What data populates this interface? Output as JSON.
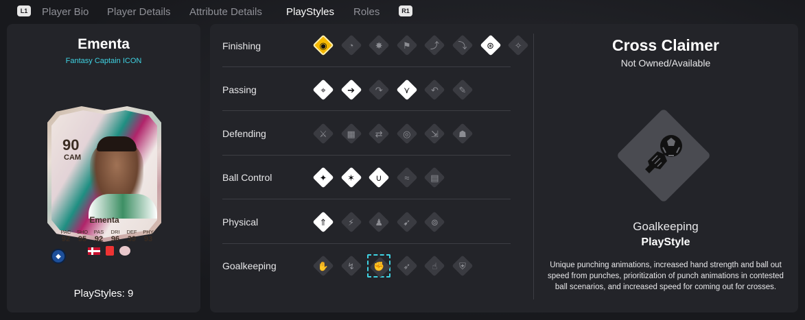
{
  "nav": {
    "left_button": "L1",
    "right_button": "R1",
    "tabs": [
      {
        "label": "Player Bio",
        "active": false
      },
      {
        "label": "Player Details",
        "active": false
      },
      {
        "label": "Attribute Details",
        "active": false
      },
      {
        "label": "PlayStyles",
        "active": true
      },
      {
        "label": "Roles",
        "active": false
      }
    ]
  },
  "player": {
    "name": "Ementa",
    "version": "Fantasy Captain ICON",
    "playstyles_count_label": "PlayStyles: 9",
    "card": {
      "rating": "90",
      "position": "CAM",
      "name": "Ementa",
      "stat_labels": [
        "PAC",
        "SHO",
        "PAS",
        "DRI",
        "DEF",
        "PHY"
      ],
      "stat_values": [
        "92",
        "95",
        "92",
        "96",
        "39",
        "93"
      ],
      "nation": "Denmark"
    }
  },
  "categories": [
    {
      "label": "Finishing",
      "icons": [
        {
          "name": "finesse-shot-icon",
          "state": "plus",
          "glyph": "◉"
        },
        {
          "name": "chip-shot-icon",
          "state": "locked",
          "glyph": "◔"
        },
        {
          "name": "power-shot-icon",
          "state": "locked",
          "glyph": "✸"
        },
        {
          "name": "dead-ball-icon",
          "state": "locked",
          "glyph": "⚑"
        },
        {
          "name": "precision-header-icon",
          "state": "locked",
          "glyph": "⤴"
        },
        {
          "name": "acrobatic-icon",
          "state": "locked",
          "glyph": "⤵"
        },
        {
          "name": "low-driven-shot-icon",
          "state": "owned",
          "glyph": "⊛"
        },
        {
          "name": "gamechanger-icon",
          "state": "locked",
          "glyph": "✧"
        }
      ]
    },
    {
      "label": "Passing",
      "icons": [
        {
          "name": "incisive-pass-icon",
          "state": "owned",
          "glyph": "⌖"
        },
        {
          "name": "pinged-pass-icon",
          "state": "owned",
          "glyph": "➔"
        },
        {
          "name": "long-ball-pass-icon",
          "state": "locked",
          "glyph": "↷"
        },
        {
          "name": "tiki-taka-icon",
          "state": "owned",
          "glyph": "⋎"
        },
        {
          "name": "whipped-pass-icon",
          "state": "locked",
          "glyph": "↶"
        },
        {
          "name": "inventive-icon",
          "state": "locked",
          "glyph": "✎"
        }
      ]
    },
    {
      "label": "Defending",
      "icons": [
        {
          "name": "jockey-icon",
          "state": "locked",
          "glyph": "⚔"
        },
        {
          "name": "block-icon",
          "state": "locked",
          "glyph": "▦"
        },
        {
          "name": "intercept-icon",
          "state": "locked",
          "glyph": "⇄"
        },
        {
          "name": "anticipate-icon",
          "state": "locked",
          "glyph": "◎"
        },
        {
          "name": "slide-tackle-icon",
          "state": "locked",
          "glyph": "⇲"
        },
        {
          "name": "bruiser-icon",
          "state": "locked",
          "glyph": "☗"
        }
      ]
    },
    {
      "label": "Ball Control",
      "icons": [
        {
          "name": "technical-icon",
          "state": "owned",
          "glyph": "✦"
        },
        {
          "name": "rapid-icon",
          "state": "owned",
          "glyph": "✶"
        },
        {
          "name": "first-touch-icon",
          "state": "owned",
          "glyph": "∪"
        },
        {
          "name": "trickster-icon",
          "state": "locked",
          "glyph": "≈"
        },
        {
          "name": "press-proven-icon",
          "state": "locked",
          "glyph": "▤"
        }
      ]
    },
    {
      "label": "Physical",
      "icons": [
        {
          "name": "quick-step-icon",
          "state": "owned",
          "glyph": "⇑"
        },
        {
          "name": "relentless-icon",
          "state": "locked",
          "glyph": "⚡"
        },
        {
          "name": "trivela-icon",
          "state": "locked",
          "glyph": "♟"
        },
        {
          "name": "aerial-icon",
          "state": "locked",
          "glyph": "➹"
        },
        {
          "name": "long-throw-icon",
          "state": "locked",
          "glyph": "⊚"
        }
      ]
    },
    {
      "label": "Goalkeeping",
      "icons": [
        {
          "name": "far-throw-icon",
          "state": "locked",
          "glyph": "✋"
        },
        {
          "name": "footwork-icon",
          "state": "locked",
          "glyph": "↯"
        },
        {
          "name": "cross-claimer-icon",
          "state": "selected",
          "glyph": "✊"
        },
        {
          "name": "rush-out-icon",
          "state": "locked",
          "glyph": "➶"
        },
        {
          "name": "far-reach-icon",
          "state": "locked",
          "glyph": "☝"
        },
        {
          "name": "deflector-icon",
          "state": "locked",
          "glyph": "⛨"
        }
      ]
    }
  ],
  "detail": {
    "title": "Cross Claimer",
    "status": "Not Owned/Available",
    "category": "Goalkeeping",
    "type": "PlayStyle",
    "description": "Unique punching animations, increased hand strength and ball out speed from punches, prioritization of punch animations in contested ball scenarios, and increased speed for coming out for crosses.",
    "icon": "cross-claimer-icon"
  }
}
